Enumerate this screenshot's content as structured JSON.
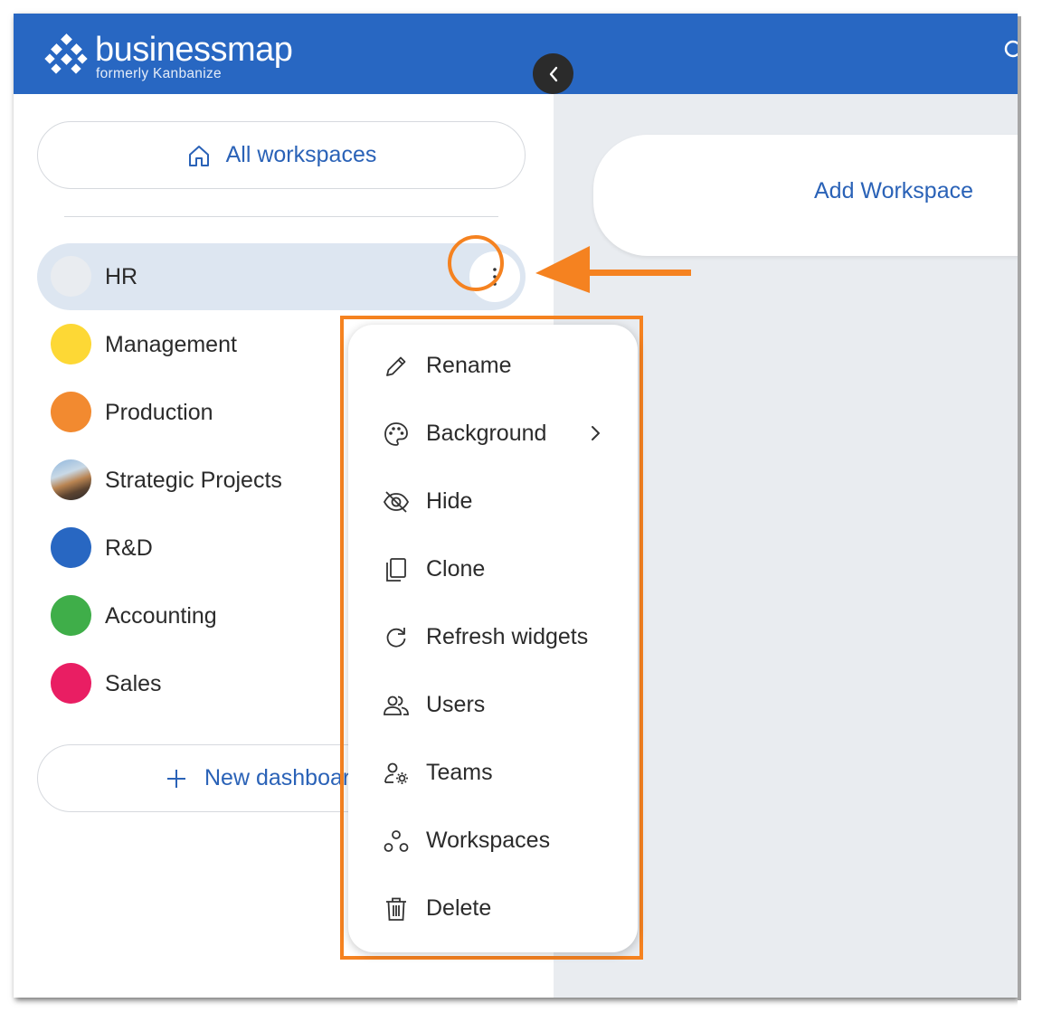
{
  "brand": {
    "name": "businessmap",
    "subtitle": "formerly Kanbanize"
  },
  "sidebar": {
    "all_workspaces_label": "All workspaces",
    "workspaces": [
      {
        "label": "HR",
        "color": "#e9ecf0",
        "active": true
      },
      {
        "label": "Management",
        "color": "#fdd835"
      },
      {
        "label": "Production",
        "color": "#f28a30"
      },
      {
        "label": "Strategic Projects",
        "color": "image"
      },
      {
        "label": "R&D",
        "color": "#2867c2"
      },
      {
        "label": "Accounting",
        "color": "#3fae49"
      },
      {
        "label": "Sales",
        "color": "#e91e63"
      }
    ],
    "new_dashboard_label": "New dashboard"
  },
  "main": {
    "add_workspace_label": "Add Workspace"
  },
  "context_menu": {
    "items": [
      {
        "label": "Rename",
        "icon": "pencil-icon"
      },
      {
        "label": "Background",
        "icon": "palette-icon",
        "submenu": true
      },
      {
        "label": "Hide",
        "icon": "eye-off-icon"
      },
      {
        "label": "Clone",
        "icon": "copy-icon"
      },
      {
        "label": "Refresh widgets",
        "icon": "refresh-icon"
      },
      {
        "label": "Users",
        "icon": "users-icon"
      },
      {
        "label": "Teams",
        "icon": "teams-icon"
      },
      {
        "label": "Workspaces",
        "icon": "workspaces-icon"
      },
      {
        "label": "Delete",
        "icon": "trash-icon"
      }
    ]
  },
  "colors": {
    "brand_blue": "#2867c2",
    "link_blue": "#2a62b7",
    "highlight_orange": "#f58220"
  }
}
